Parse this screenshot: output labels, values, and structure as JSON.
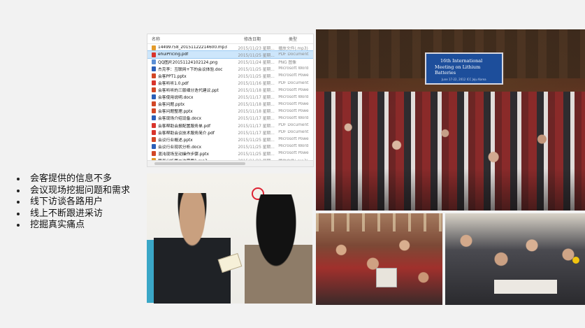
{
  "bullets": [
    "会客提供的信息不多",
    "会议现场挖掘问题和需求",
    "线下访谈各路用户",
    "线上不断跟进采访",
    "挖掘真实痛点"
  ],
  "file_list": {
    "columns": [
      "名称",
      "修改日期",
      "类型"
    ],
    "rows": [
      {
        "name": "14499758_20151122214600.mp3",
        "date": "2015/11/23 星期...",
        "type": "播放文件(.mp3)",
        "icon_color": "#e39b2b",
        "selected": false
      },
      {
        "name": "ehuiPricing.pdf",
        "date": "2015/11/25 星期...",
        "type": "PDF Document",
        "icon_color": "#d9342b",
        "selected": true
      },
      {
        "name": "QQ图片20151124102124.png",
        "date": "2015/11/24 星期...",
        "type": "PNG 图像",
        "icon_color": "#5b8fd6",
        "selected": false
      },
      {
        "name": "杰克李：互联网+下的会议体验.doc",
        "date": "2015/11/25 星期...",
        "type": "Microsoft Word",
        "icon_color": "#2b5fb8",
        "selected": false
      },
      {
        "name": "会客PPT1.pptx",
        "date": "2015/11/25 星期...",
        "type": "Microsoft Powe",
        "icon_color": "#d24726",
        "selected": false
      },
      {
        "name": "会客听听1.0.pdf",
        "date": "2015/11/16 星期...",
        "type": "PDF Document",
        "icon_color": "#d9342b",
        "selected": false
      },
      {
        "name": "会客听听的三版细分迭代建议.ppt",
        "date": "2015/11/18 星期...",
        "type": "Microsoft Powe",
        "icon_color": "#d24726",
        "selected": false
      },
      {
        "name": "会客使用说明.docx",
        "date": "2015/11/17 星期...",
        "type": "Microsoft Word",
        "icon_color": "#2b5fb8",
        "selected": false
      },
      {
        "name": "会客问题.pptx",
        "date": "2015/11/18 星期...",
        "type": "Microsoft Powe",
        "icon_color": "#d24726",
        "selected": false
      },
      {
        "name": "会客问题整理.pptx",
        "date": "2015/11/18 星期...",
        "type": "Microsoft Powe",
        "icon_color": "#d24726",
        "selected": false
      },
      {
        "name": "会客现场介绍设备.docx",
        "date": "2015/11/17 星期...",
        "type": "Microsoft Word",
        "icon_color": "#2b5fb8",
        "selected": false
      },
      {
        "name": "会客帮助会报配置服务单.pdf",
        "date": "2015/11/17 星期...",
        "type": "PDF Document",
        "icon_color": "#d9342b",
        "selected": false
      },
      {
        "name": "会客帮助会议技术服务简介.pdf",
        "date": "2015/11/17 星期...",
        "type": "PDF Document",
        "icon_color": "#d9342b",
        "selected": false
      },
      {
        "name": "会议行业概述.pptx",
        "date": "2015/11/25 星期...",
        "type": "Microsoft Powe",
        "icon_color": "#d24726",
        "selected": false
      },
      {
        "name": "会议行业现状分析.docx",
        "date": "2015/11/25 星期...",
        "type": "Microsoft Word",
        "icon_color": "#2b5fb8",
        "selected": false
      },
      {
        "name": "混沌现场至动操作步骤.pptx",
        "date": "2015/11/25 星期...",
        "type": "Microsoft Powe",
        "icon_color": "#d24726",
        "selected": false
      },
      {
        "name": "营员分析第二次需要1.mp3",
        "date": "2015/11/22 星期...",
        "type": "播放文件(.mp3)",
        "icon_color": "#e39b2b",
        "selected": false
      }
    ]
  },
  "conference_screen": {
    "line1": "16th International",
    "line2": "Meeting on Lithium Batteries",
    "line3": "",
    "line4": "June 17-22, 2012 ICC Jeju Korea"
  }
}
